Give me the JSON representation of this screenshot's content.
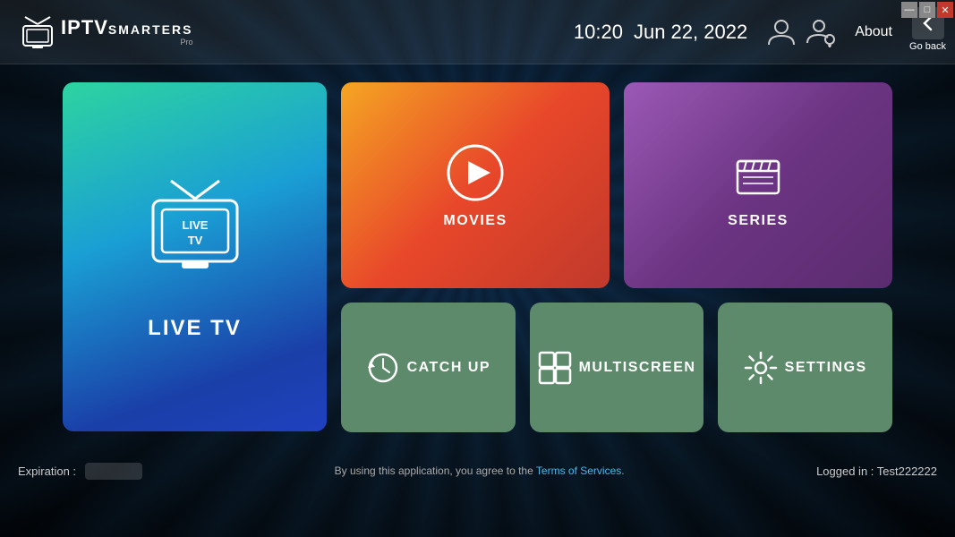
{
  "window": {
    "min_label": "—",
    "max_label": "□",
    "close_label": "✕"
  },
  "header": {
    "logo_iptv": "IPTV",
    "logo_smarters": "SMARTERS",
    "logo_pro": "Pro",
    "time": "10:20",
    "date": "Jun 22, 2022",
    "about_label": "About",
    "go_back_label": "Go back"
  },
  "cards": {
    "live_tv_label": "LIVE TV",
    "movies_label": "MOVIES",
    "series_label": "SERIES",
    "catchup_label": "CATCH UP",
    "multiscreen_label": "MULTISCREEN",
    "settings_label": "SETTINGS"
  },
  "footer": {
    "expiry_label": "Expiration :",
    "expiry_value": "",
    "tos_text": "By using this application, you agree to the",
    "tos_link": "Terms of Services.",
    "logged_in": "Logged in : Test222222"
  },
  "colors": {
    "accent_teal": "#2dd4a0",
    "accent_blue": "#1a9fd4",
    "accent_orange": "#f5a623",
    "accent_red": "#e8472a",
    "accent_purple": "#9b59b6",
    "accent_green": "#5d8a6a"
  }
}
